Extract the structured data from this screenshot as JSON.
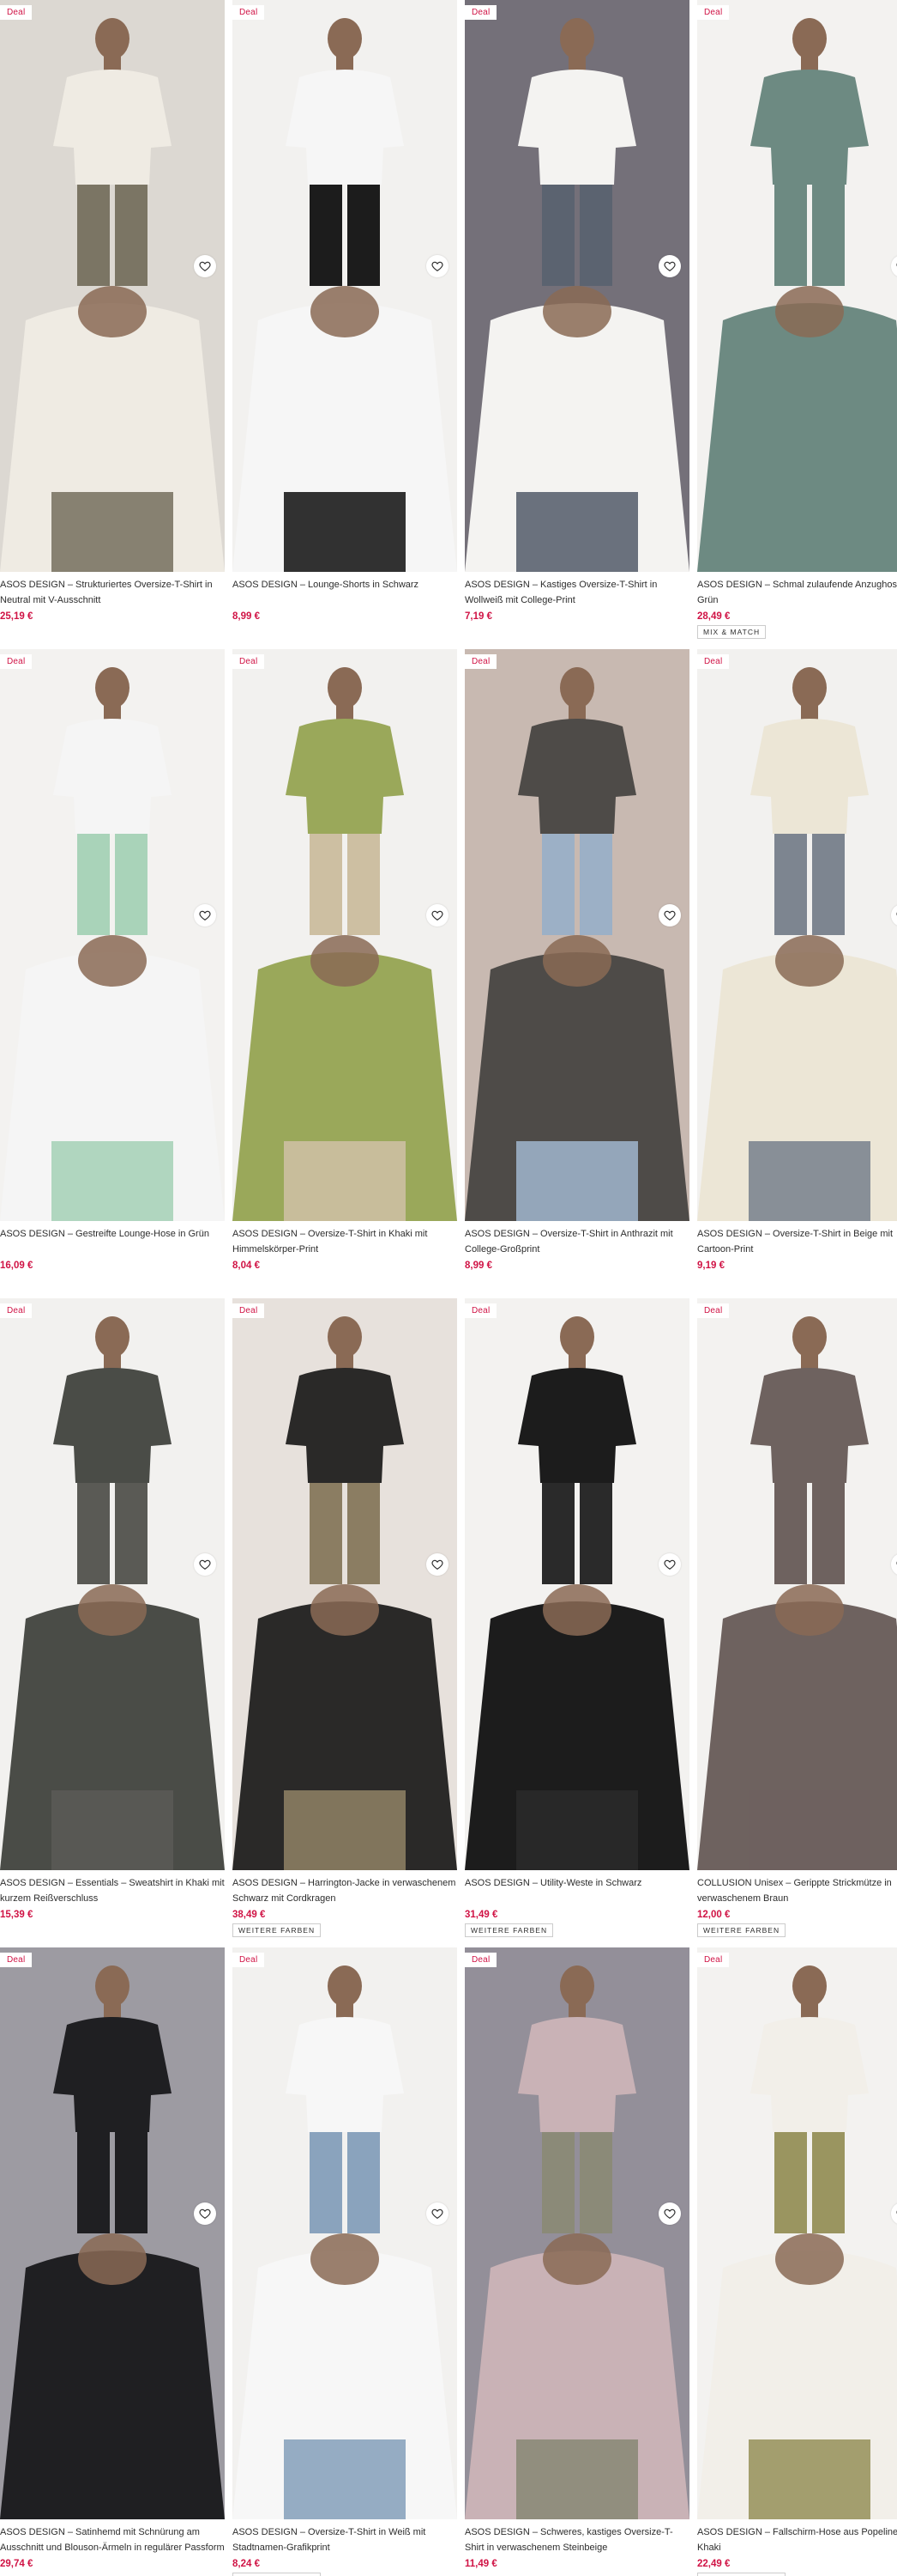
{
  "labels": {
    "deal": "Deal",
    "mix_match": "MIX & MATCH",
    "more_colors": "WEITERE FARBEN"
  },
  "products": [
    {
      "title": "ASOS DESIGN – Strukturiertes Oversize-T-Shirt in Neutral mit V-Ausschnitt",
      "price": "25,19 €",
      "tag": "",
      "bg": "#dcd8d2",
      "garment": "#efebe3",
      "pants": "#7b7564"
    },
    {
      "title": "ASOS DESIGN – Lounge-Shorts in Schwarz",
      "price": "8,99 €",
      "tag": "",
      "bg": "#f2f1ef",
      "garment": "#f6f6f6",
      "pants": "#1c1c1c"
    },
    {
      "title": "ASOS DESIGN – Kastiges Oversize-T-Shirt in Wollweiß mit College-Print",
      "price": "7,19 €",
      "tag": "",
      "bg": "#747079",
      "garment": "#f4f3f1",
      "pants": "#5b6370"
    },
    {
      "title": "ASOS DESIGN – Schmal zulaufende Anzughose in Grün",
      "price": "28,49 €",
      "tag": "MIX & MATCH",
      "bg": "#f3f2f0",
      "garment": "#6d8a82",
      "pants": "#6d8a82"
    },
    {
      "title": "ASOS DESIGN – Gestreifte Lounge-Hose in Grün",
      "price": "16,09 €",
      "tag": "",
      "bg": "#f3f2f0",
      "garment": "#f5f5f5",
      "pants": "#a9d3b9"
    },
    {
      "title": "ASOS DESIGN – Oversize-T-Shirt in Khaki mit Himmelskörper-Print",
      "price": "8,04 €",
      "tag": "",
      "bg": "#f2f1ef",
      "garment": "#9aa85a",
      "pants": "#cdbfa2"
    },
    {
      "title": "ASOS DESIGN – Oversize-T-Shirt in Anthrazit mit College-Großprint",
      "price": "8,99 €",
      "tag": "",
      "bg": "#c8b9b1",
      "garment": "#4e4b48",
      "pants": "#9cb0c6"
    },
    {
      "title": "ASOS DESIGN – Oversize-T-Shirt in Beige mit Cartoon-Print",
      "price": "9,19 €",
      "tag": "",
      "bg": "#f2f1ef",
      "garment": "#ece6d6",
      "pants": "#7d8590"
    },
    {
      "title": "ASOS DESIGN – Essentials – Sweatshirt in Khaki mit kurzem Reißverschluss",
      "price": "15,39 €",
      "tag": "",
      "bg": "#f2f1ef",
      "garment": "#4a4c47",
      "pants": "#5a5a55"
    },
    {
      "title": "ASOS DESIGN – Harrington-Jacke in verwaschenem Schwarz mit Cordkragen",
      "price": "38,49 €",
      "tag": "WEITERE FARBEN",
      "bg": "#e7e1dc",
      "garment": "#2a2928",
      "pants": "#8b7d62"
    },
    {
      "title": "ASOS DESIGN – Utility-Weste in Schwarz",
      "price": "31,49 €",
      "tag": "WEITERE FARBEN",
      "bg": "#f3f2f0",
      "garment": "#1c1c1c",
      "pants": "#2a2a2a"
    },
    {
      "title": "COLLUSION Unisex – Gerippte Strickmütze in verwaschenem Braun",
      "price": "12,00 €",
      "tag": "WEITERE FARBEN",
      "bg": "#f3f2f0",
      "garment": "#6e625f",
      "pants": "#6e625f"
    },
    {
      "title": "ASOS DESIGN – Satinhemd mit Schnürung am Ausschnitt und Blouson-Ärmeln in regulärer Passform",
      "price": "29,74 €",
      "tag": "",
      "bg": "#9d9ba2",
      "garment": "#1f1f22",
      "pants": "#1f1f22"
    },
    {
      "title": "ASOS DESIGN – Oversize-T-Shirt in Weiß mit Stadtnamen-Grafikprint",
      "price": "8,24 €",
      "tag": "WEITERE FARBEN",
      "bg": "#f2f1ef",
      "garment": "#f7f7f7",
      "pants": "#8aa3bd"
    },
    {
      "title": "ASOS DESIGN – Schweres, kastiges Oversize-T-Shirt in verwaschenem Steinbeige",
      "price": "11,49 €",
      "tag": "",
      "bg": "#938f99",
      "garment": "#c9b2b6",
      "pants": "#8b8a78"
    },
    {
      "title": "ASOS DESIGN – Fallschirm-Hose aus Popeline in Khaki",
      "price": "22,49 €",
      "tag": "WEITERE FARBEN",
      "bg": "#f3f2f0",
      "garment": "#f2efe9",
      "pants": "#9a9560"
    }
  ]
}
